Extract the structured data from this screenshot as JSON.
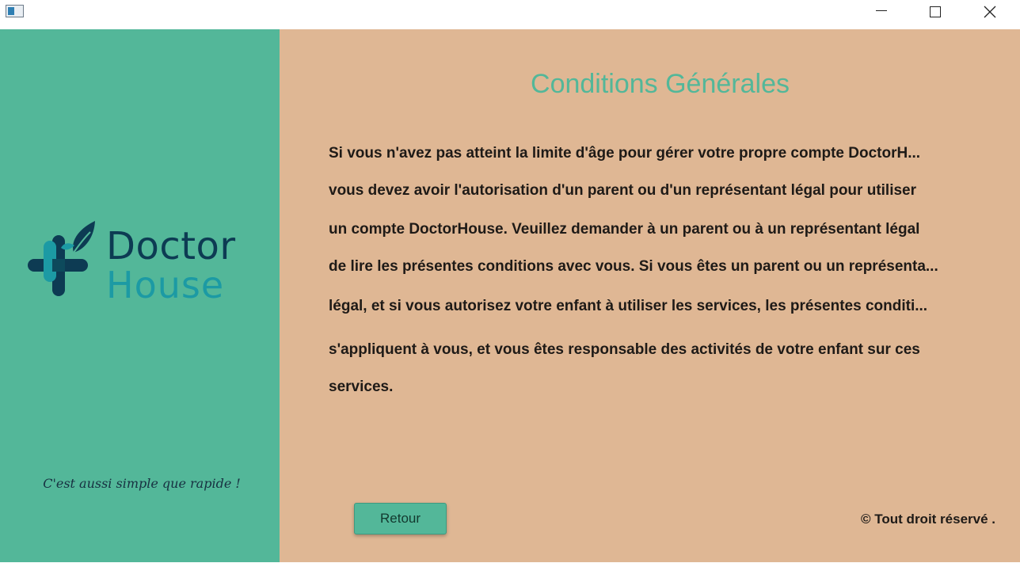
{
  "brand": {
    "name_line1": "Doctor",
    "name_line2": "House",
    "slogan": "C'est aussi simple que rapide !",
    "colors": {
      "panel_green": "#53b799",
      "panel_tan": "#dfb794",
      "logo_dark": "#0d3b53",
      "logo_teal": "#1c9aa4"
    }
  },
  "window": {
    "icons": [
      "app-icon",
      "minimize-icon",
      "maximize-icon",
      "close-icon"
    ]
  },
  "content": {
    "title": "Conditions Générales",
    "lines": [
      "Si vous n'avez pas atteint la limite d'âge pour gérer votre propre compte DoctorH...",
      "vous devez avoir l'autorisation d'un parent ou d'un représentant légal pour utiliser",
      "un compte DoctorHouse. Veuillez demander à un parent ou à un représentant légal",
      "de lire les présentes conditions avec vous. Si vous êtes un parent ou un représenta...",
      "légal, et si vous autorisez votre enfant à utiliser les services,  les présentes conditi...",
      "s'appliquent à vous, et vous êtes responsable des activités de votre enfant sur ces",
      "services."
    ]
  },
  "footer": {
    "back_label": "Retour",
    "copyright": "© Tout droit réservé ."
  }
}
